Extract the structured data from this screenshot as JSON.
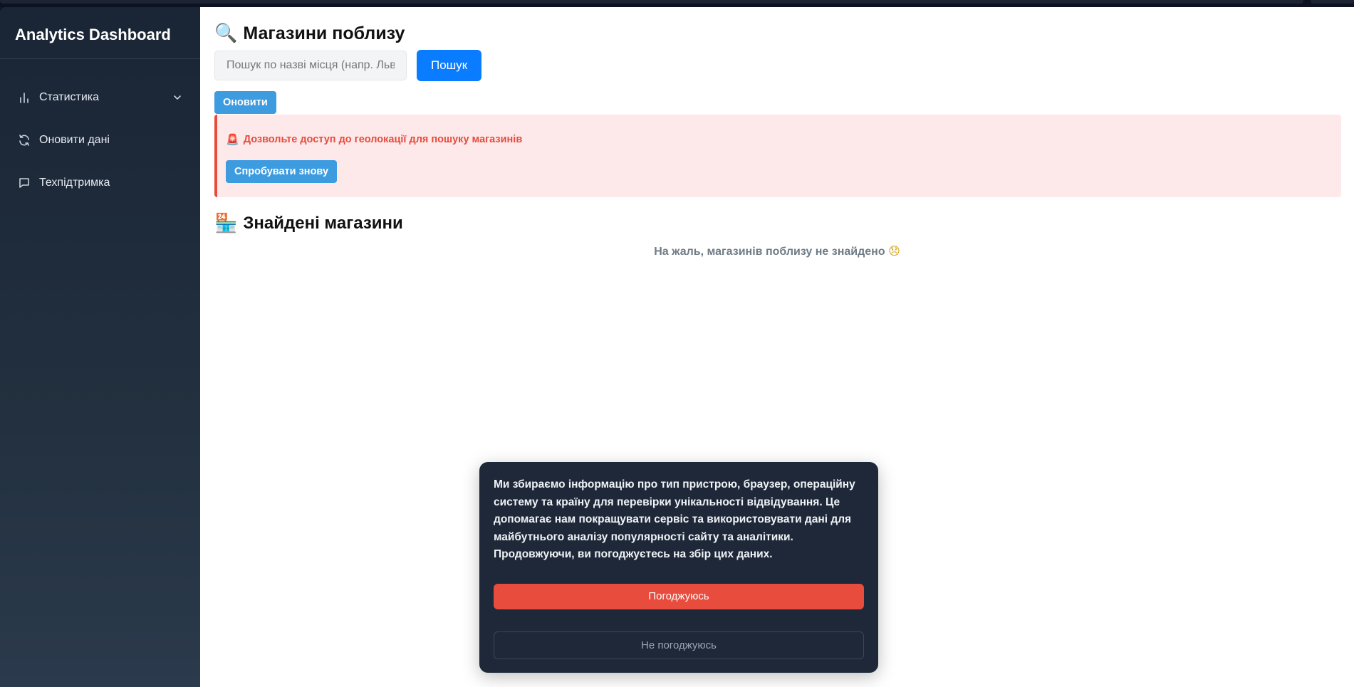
{
  "sidebar": {
    "brand": "Analytics Dashboard",
    "items": [
      {
        "label": "Статистика",
        "icon": "bar-chart-icon",
        "has_submenu": true
      },
      {
        "label": "Оновити дані",
        "icon": "refresh-icon"
      },
      {
        "label": "Техпідтримка",
        "icon": "chat-icon"
      }
    ]
  },
  "main": {
    "title_emoji": "🔍",
    "title": "Магазини поблизу",
    "search": {
      "placeholder": "Пошук по назві місця (напр. Львів)",
      "value": "",
      "button_label": "Пошук"
    },
    "refresh_label": "Оновити",
    "alert": {
      "icon": "🚨",
      "text": "Дозвольте доступ до геолокації для пошуку магазинів",
      "retry_label": "Спробувати знову"
    },
    "found": {
      "emoji": "🏪",
      "title": "Знайдені магазини",
      "empty_text": "На жаль, магазинів поблизу не знайдено",
      "empty_emoji": "😞"
    }
  },
  "consent": {
    "text": "Ми збираємо інформацію про тип пристрою, браузер, операційну систему та країну для перевірки унікальності відвідування. Це допомагає нам покращувати сервіс та використовувати дані для майбутнього аналізу популярності сайту та аналітики. Продовжуючи, ви погоджуєтесь на збір цих даних.",
    "agree_label": "Погоджуюсь",
    "disagree_label": "Не погоджуюсь"
  },
  "colors": {
    "primary_blue": "#0a7cff",
    "secondary_blue": "#3d9be0",
    "alert_red": "#e64b3c",
    "alert_bg": "#fde9ea",
    "sidebar_bg": "#1a2535",
    "consent_bg": "#1e2838"
  }
}
